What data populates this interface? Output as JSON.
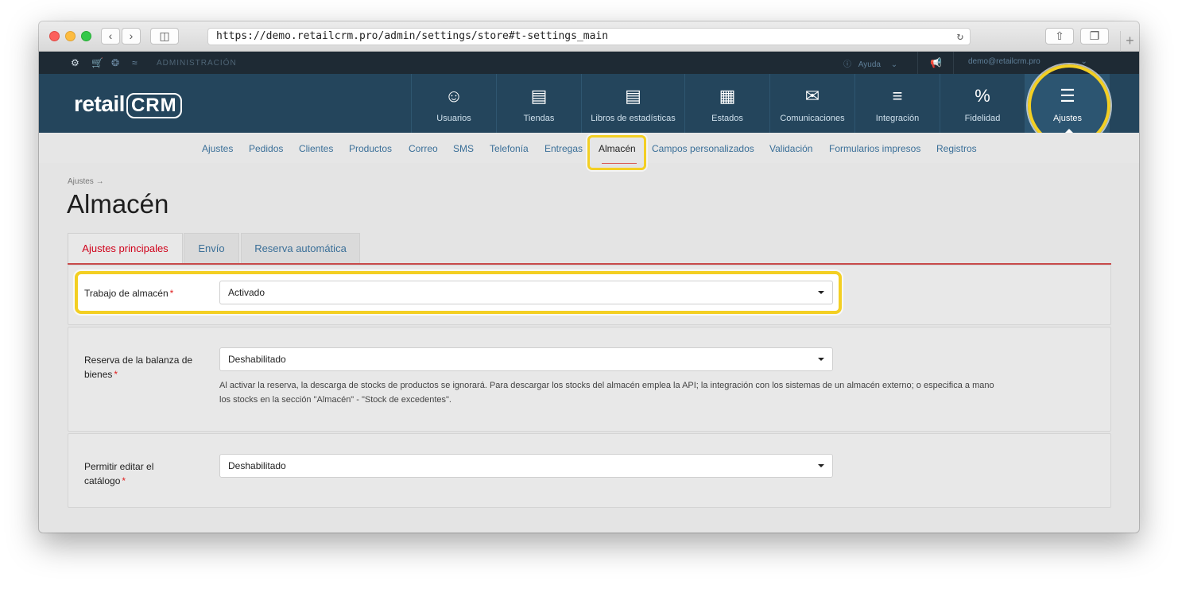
{
  "browser": {
    "url": "https://demo.retailcrm.pro/admin/settings/store#t-settings_main",
    "new_tab": "+"
  },
  "admin_bar": {
    "label": "ADMINISTRACIÓN",
    "help": "Ayuda",
    "user": "demo@retailcrm.pro"
  },
  "brand": {
    "logo_prefix": "retail",
    "logo_suffix": "CRM"
  },
  "modules": [
    {
      "label": "Usuarios",
      "icon": "user-icon"
    },
    {
      "label": "Tiendas",
      "icon": "shop-icon"
    },
    {
      "label": "Libros de estadísticas",
      "icon": "book-icon"
    },
    {
      "label": "Estados",
      "icon": "grid-icon"
    },
    {
      "label": "Comunicaciones",
      "icon": "message-icon"
    },
    {
      "label": "Integración",
      "icon": "integration-icon"
    },
    {
      "label": "Fidelidad",
      "icon": "percent-icon"
    },
    {
      "label": "Ajustes",
      "icon": "sliders-icon",
      "active": true
    }
  ],
  "subnav": [
    {
      "label": "Ajustes"
    },
    {
      "label": "Pedidos"
    },
    {
      "label": "Clientes"
    },
    {
      "label": "Productos"
    },
    {
      "label": "Correo"
    },
    {
      "label": "SMS"
    },
    {
      "label": "Telefonía"
    },
    {
      "label": "Entregas"
    },
    {
      "label": "Almacén",
      "active": true
    },
    {
      "label": "Campos personalizados"
    },
    {
      "label": "Validación"
    },
    {
      "label": "Formularios impresos"
    },
    {
      "label": "Registros"
    }
  ],
  "page": {
    "breadcrumb": "Ajustes →",
    "title": "Almacén"
  },
  "tabs": [
    {
      "label": "Ajustes principales",
      "active": true
    },
    {
      "label": "Envío"
    },
    {
      "label": "Reserva automática"
    }
  ],
  "fields": {
    "warehouse_work": {
      "label": "Trabajo de almacén",
      "required": "*",
      "value": "Activado"
    },
    "reserve_balance": {
      "label": "Reserva de la balanza de bienes",
      "required": "*",
      "value": "Deshabilitado",
      "hint": "Al activar la reserva, la descarga de stocks de productos se ignorará. Para descargar los stocks del almacén emplea la API; la integración con los sistemas de un almacén externo; o especifica a mano los stocks en la sección \"Almacén\" - \"Stock de excedentes\"."
    },
    "edit_catalog": {
      "label": "Permitir editar el catálogo",
      "required": "*",
      "value": "Deshabilitado"
    }
  },
  "colors": {
    "header_bg": "#24455c",
    "admin_bar_bg": "#1e2a34",
    "highlight": "#f3cf23",
    "link": "#3a6f98",
    "active_tab": "#d0021b"
  }
}
